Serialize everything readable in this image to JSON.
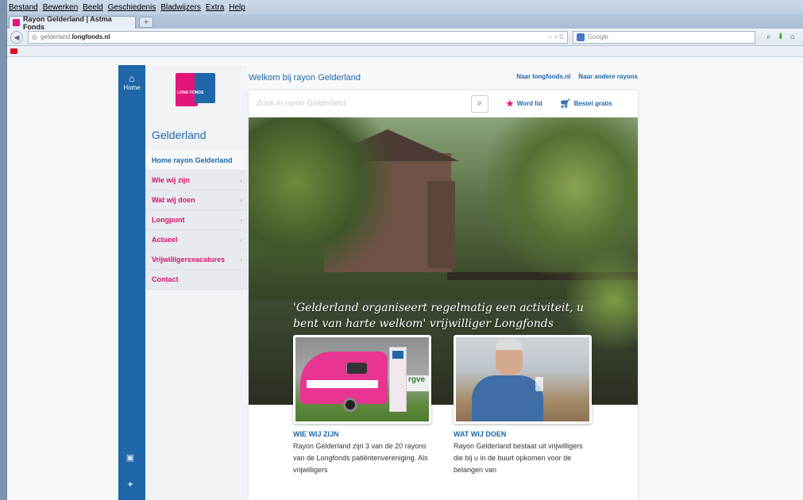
{
  "browser": {
    "menu": [
      "Bestand",
      "Bewerken",
      "Beeld",
      "Geschiedenis",
      "Bladwijzers",
      "Extra",
      "Help"
    ],
    "tab_title": "Rayon Gelderland | Astma Fonds",
    "new_tab": "+",
    "url_prefix": "gelderland.",
    "url_domain": "longfonds.nl",
    "search_placeholder": "Google"
  },
  "site": {
    "home_label": "Home",
    "logo_text": "LONG FONDS",
    "region_title": "Gelderland",
    "nav": [
      {
        "label": "Home rayon Gelderland"
      },
      {
        "label": "Wie wij zijn"
      },
      {
        "label": "Wat wij doen"
      },
      {
        "label": "Longpunt"
      },
      {
        "label": "Actueel"
      },
      {
        "label": "Vrijwilligersvacatures"
      },
      {
        "label": "Contact"
      }
    ],
    "welcome": "Welkom bij rayon Gelderland",
    "top_links": [
      "Naar longfonds.nl",
      "Naar andere rayons"
    ],
    "search_placeholder": "Zoek in rayon Gelderland",
    "cta_member": "Word lid",
    "cta_order": "Bestel gratis",
    "hero_text": "'Gelderland organiseert regelmatig een activiteit, u bent van harte welkom' vrijwilliger Longfonds",
    "cards": [
      {
        "title": "WIE WIJ ZIJN",
        "text": "Rayon Gelderland zijn 3 van de 20 rayons van de Longfonds patiëntenvereniging. Als vrijwilligers",
        "sign": "rgve"
      },
      {
        "title": "WAT WIJ DOEN",
        "text": "Rayon Gelderland bestaat uit vrijwilligers die bij u in de buurt opkomen voor de belangen van"
      }
    ]
  },
  "colors": {
    "brand_blue": "#1f67a8",
    "brand_pink": "#e4147a"
  }
}
